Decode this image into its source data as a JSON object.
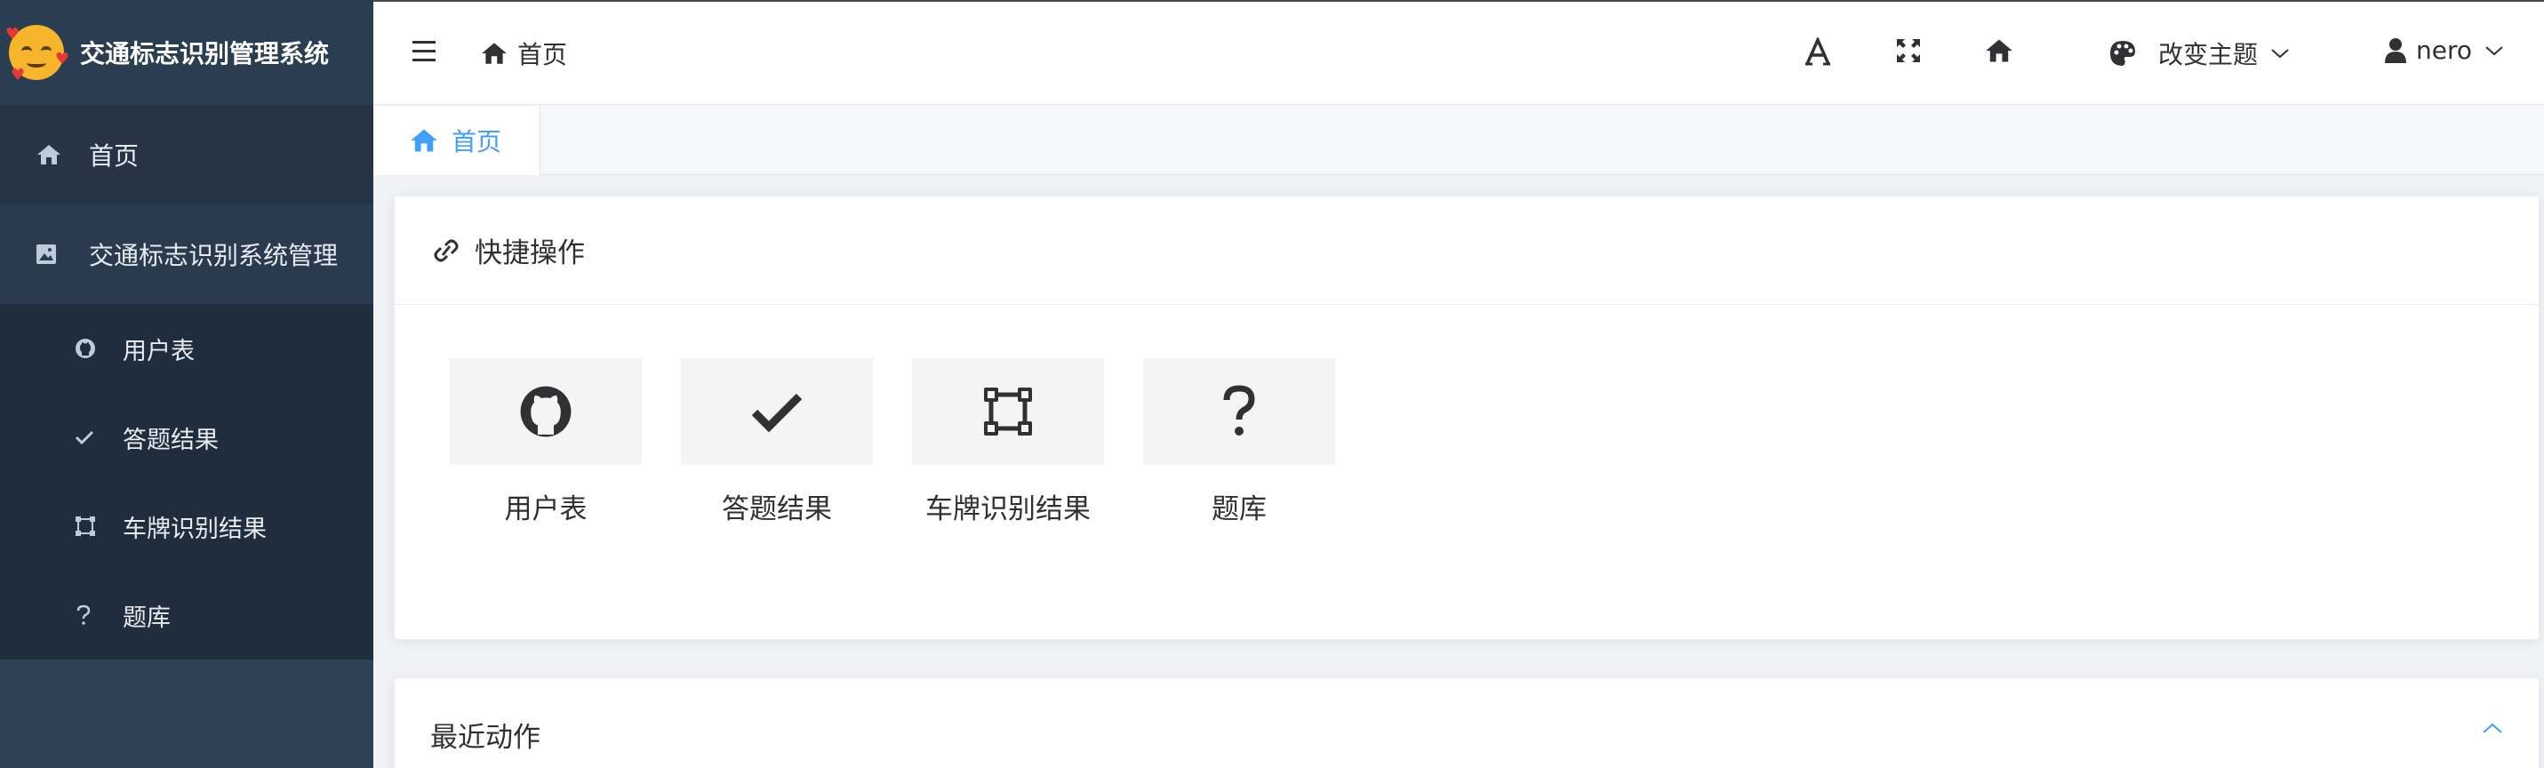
{
  "app": {
    "title": "交通标志识别管理系统"
  },
  "sidebar": {
    "items": [
      {
        "label": "首页",
        "icon": "home-icon"
      },
      {
        "label": "交通标志识别系统管理",
        "icon": "image-icon"
      }
    ],
    "submenu": [
      {
        "label": "用户表",
        "icon": "github-icon"
      },
      {
        "label": "答题结果",
        "icon": "check-icon"
      },
      {
        "label": "车牌识别结果",
        "icon": "vector-square-icon"
      },
      {
        "label": "题库",
        "icon": "question-icon"
      }
    ]
  },
  "header": {
    "breadcrumb": "首页",
    "theme_label": "改变主题",
    "user_name": "nero"
  },
  "tags": {
    "active": "首页"
  },
  "quick_actions": {
    "title": "快捷操作",
    "items": [
      {
        "label": "用户表",
        "icon": "github-icon"
      },
      {
        "label": "答题结果",
        "icon": "check-icon"
      },
      {
        "label": "车牌识别结果",
        "icon": "vector-square-icon"
      },
      {
        "label": "题库",
        "icon": "question-icon"
      }
    ]
  },
  "recent": {
    "title": "最近动作"
  },
  "colors": {
    "sidebar_bg": "#304156",
    "accent": "#409eff"
  }
}
